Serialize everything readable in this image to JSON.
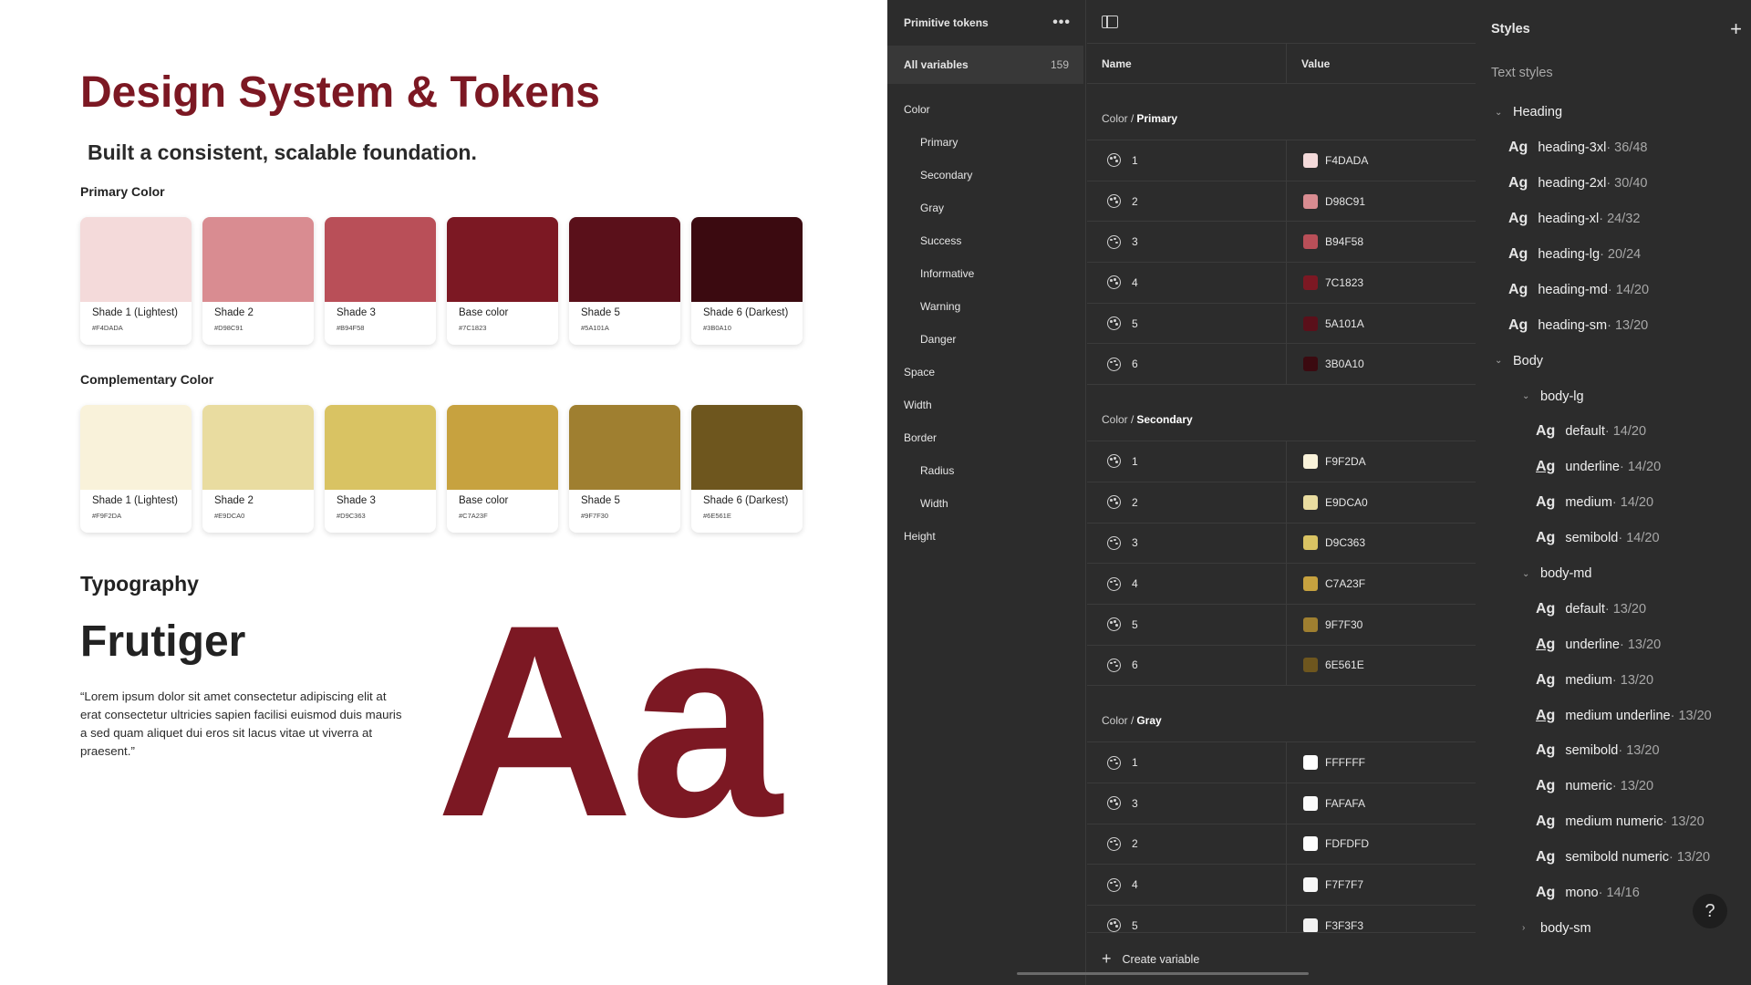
{
  "design_page": {
    "title": "Design System & Tokens",
    "subtitle": "Built a consistent, scalable foundation.",
    "primary_label": "Primary Color",
    "primary_swatches": [
      {
        "name": "Shade 1 (Lightest)",
        "hex": "#F4DADA",
        "color": "#F4DADA"
      },
      {
        "name": "Shade 2",
        "hex": "#D98C91",
        "color": "#D98C91"
      },
      {
        "name": "Shade 3",
        "hex": "#B94F58",
        "color": "#B94F58"
      },
      {
        "name": "Base color",
        "hex": "#7C1823",
        "color": "#7C1823"
      },
      {
        "name": "Shade 5",
        "hex": "#5A101A",
        "color": "#5A101A"
      },
      {
        "name": "Shade 6 (Darkest)",
        "hex": "#3B0A10",
        "color": "#3B0A10"
      }
    ],
    "complementary_label": "Complementary Color",
    "complementary_swatches": [
      {
        "name": "Shade 1 (Lightest)",
        "hex": "#F9F2DA",
        "color": "#F9F2DA"
      },
      {
        "name": "Shade 2",
        "hex": "#E9DCA0",
        "color": "#E9DCA0"
      },
      {
        "name": "Shade 3",
        "hex": "#D9C363",
        "color": "#D9C363"
      },
      {
        "name": "Base color",
        "hex": "#C7A23F",
        "color": "#C7A23F"
      },
      {
        "name": "Shade 5",
        "hex": "#9F7F30",
        "color": "#9F7F30"
      },
      {
        "name": "Shade 6 (Darkest)",
        "hex": "#6E561E",
        "color": "#6E561E"
      }
    ],
    "typography_label": "Typography",
    "font_name": "Frutiger",
    "lorem": "“Lorem ipsum dolor sit amet consectetur adipiscing elit at erat consectetur ultricies sapien facilisi euismod duis mauris a sed quam aliquet dui eros sit lacus vitae ut viverra at praesent.”",
    "big_sample": "Aa"
  },
  "collections": {
    "title": "Primitive tokens",
    "more_icon": "more-dots-icon",
    "all_variables_label": "All variables",
    "all_variables_count": "159",
    "groups": [
      {
        "label": "Color",
        "level": 0
      },
      {
        "label": "Primary",
        "level": 1
      },
      {
        "label": "Secondary",
        "level": 1
      },
      {
        "label": "Gray",
        "level": 1
      },
      {
        "label": "Success",
        "level": 1
      },
      {
        "label": "Informative",
        "level": 1
      },
      {
        "label": "Warning",
        "level": 1
      },
      {
        "label": "Danger",
        "level": 1
      },
      {
        "label": "Space",
        "level": 0
      },
      {
        "label": "Width",
        "level": 0
      },
      {
        "label": "Border",
        "level": 0
      },
      {
        "label": "Radius",
        "level": 1
      },
      {
        "label": "Width",
        "level": 1
      },
      {
        "label": "Height",
        "level": 0
      }
    ]
  },
  "table": {
    "col_name": "Name",
    "col_value": "Value",
    "sections": [
      {
        "prefix": "Color /",
        "name": "Primary",
        "rows": [
          {
            "name": "1",
            "value": "F4DADA",
            "color": "#F4DADA"
          },
          {
            "name": "2",
            "value": "D98C91",
            "color": "#D98C91"
          },
          {
            "name": "3",
            "value": "B94F58",
            "color": "#B94F58"
          },
          {
            "name": "4",
            "value": "7C1823",
            "color": "#7C1823"
          },
          {
            "name": "5",
            "value": "5A101A",
            "color": "#5A101A"
          },
          {
            "name": "6",
            "value": "3B0A10",
            "color": "#3B0A10"
          }
        ]
      },
      {
        "prefix": "Color /",
        "name": "Secondary",
        "rows": [
          {
            "name": "1",
            "value": "F9F2DA",
            "color": "#F9F2DA"
          },
          {
            "name": "2",
            "value": "E9DCA0",
            "color": "#E9DCA0"
          },
          {
            "name": "3",
            "value": "D9C363",
            "color": "#D9C363"
          },
          {
            "name": "4",
            "value": "C7A23F",
            "color": "#C7A23F"
          },
          {
            "name": "5",
            "value": "9F7F30",
            "color": "#9F7F30"
          },
          {
            "name": "6",
            "value": "6E561E",
            "color": "#6E561E"
          }
        ]
      },
      {
        "prefix": "Color /",
        "name": "Gray",
        "rows": [
          {
            "name": "1",
            "value": "FFFFFF",
            "color": "#FFFFFF"
          },
          {
            "name": "3",
            "value": "FAFAFA",
            "color": "#FAFAFA"
          },
          {
            "name": "2",
            "value": "FDFDFD",
            "color": "#FDFDFD"
          },
          {
            "name": "4",
            "value": "F7F7F7",
            "color": "#F7F7F7"
          },
          {
            "name": "5",
            "value": "F3F3F3",
            "color": "#F3F3F3"
          }
        ]
      }
    ],
    "create_variable_label": "Create variable"
  },
  "styles": {
    "title": "Styles",
    "add_icon": "plus-icon",
    "text_styles_label": "Text styles",
    "items": [
      {
        "kind": "folder",
        "level": 0,
        "label": "Heading",
        "open": true
      },
      {
        "kind": "style",
        "level": 1,
        "ag": "Ag",
        "label": "heading-3xl",
        "meta": " · 36/48"
      },
      {
        "kind": "style",
        "level": 1,
        "ag": "Ag",
        "label": "heading-2xl",
        "meta": " · 30/40"
      },
      {
        "kind": "style",
        "level": 1,
        "ag": "Ag",
        "label": "heading-xl",
        "meta": " · 24/32"
      },
      {
        "kind": "style",
        "level": 1,
        "ag": "Ag",
        "label": "heading-lg",
        "meta": " · 20/24"
      },
      {
        "kind": "style",
        "level": 1,
        "ag": "Ag",
        "label": "heading-md",
        "meta": " · 14/20"
      },
      {
        "kind": "style",
        "level": 1,
        "ag": "Ag",
        "label": "heading-sm",
        "meta": " · 13/20"
      },
      {
        "kind": "folder",
        "level": 0,
        "label": "Body",
        "open": true
      },
      {
        "kind": "folder",
        "level": "sub",
        "label": "body-lg",
        "open": true
      },
      {
        "kind": "style",
        "level": 2,
        "ag": "Ag",
        "label": "default",
        "meta": " · 14/20"
      },
      {
        "kind": "style",
        "level": 2,
        "ag": "Ag",
        "label": "underline",
        "meta": " · 14/20",
        "underline": true
      },
      {
        "kind": "style",
        "level": 2,
        "ag": "Ag",
        "label": "medium",
        "meta": " · 14/20"
      },
      {
        "kind": "style",
        "level": 2,
        "ag": "Ag",
        "label": "semibold",
        "meta": " · 14/20"
      },
      {
        "kind": "folder",
        "level": "sub",
        "label": "body-md",
        "open": true
      },
      {
        "kind": "style",
        "level": 2,
        "ag": "Ag",
        "label": "default",
        "meta": " · 13/20"
      },
      {
        "kind": "style",
        "level": 2,
        "ag": "Ag",
        "label": "underline",
        "meta": " · 13/20",
        "underline": true
      },
      {
        "kind": "style",
        "level": 2,
        "ag": "Ag",
        "label": "medium",
        "meta": " · 13/20"
      },
      {
        "kind": "style",
        "level": 2,
        "ag": "Ag",
        "label": "medium underline",
        "meta": " · 13/20",
        "underline": true
      },
      {
        "kind": "style",
        "level": 2,
        "ag": "Ag",
        "label": "semibold",
        "meta": " · 13/20"
      },
      {
        "kind": "style",
        "level": 2,
        "ag": "Ag",
        "label": "numeric",
        "meta": " · 13/20"
      },
      {
        "kind": "style",
        "level": 2,
        "ag": "Ag",
        "label": "medium numeric",
        "meta": " · 13/20"
      },
      {
        "kind": "style",
        "level": 2,
        "ag": "Ag",
        "label": "semibold numeric",
        "meta": " · 13/20"
      },
      {
        "kind": "style",
        "level": 2,
        "ag": "Ag",
        "label": "mono",
        "meta": " · 14/16"
      },
      {
        "kind": "folder",
        "level": "sub",
        "label": "body-sm",
        "open": false
      }
    ],
    "help_label": "?"
  }
}
